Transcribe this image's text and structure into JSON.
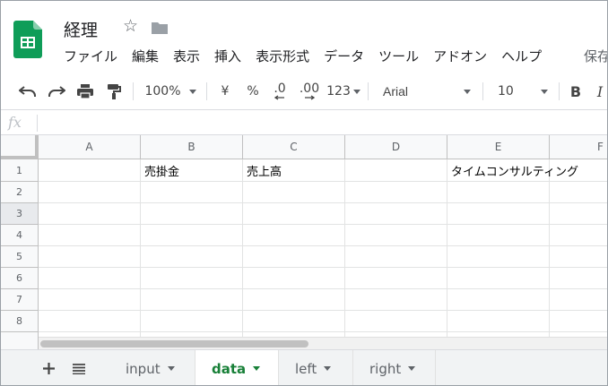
{
  "header": {
    "title": "経理",
    "save_status": "保存"
  },
  "menu": [
    {
      "label": "ファイル"
    },
    {
      "label": "編集"
    },
    {
      "label": "表示"
    },
    {
      "label": "挿入"
    },
    {
      "label": "表示形式"
    },
    {
      "label": "データ"
    },
    {
      "label": "ツール"
    },
    {
      "label": "アドオン"
    },
    {
      "label": "ヘルプ"
    }
  ],
  "toolbar": {
    "zoom": "100%",
    "currency": "¥",
    "percent": "%",
    "decrease_decimal": ".0",
    "increase_decimal": ".00",
    "number_format": "123",
    "font": "Arial",
    "font_size": "10",
    "bold": "B",
    "italic": "I"
  },
  "formula_bar": {
    "fx_label": "fx",
    "value": ""
  },
  "columns": [
    "A",
    "B",
    "C",
    "D",
    "E",
    "F"
  ],
  "rows": [
    "1",
    "2",
    "3",
    "4",
    "5",
    "6",
    "7",
    "8"
  ],
  "cells": {
    "B1": "売掛金",
    "C1": "売上高",
    "E1": "タイムコンサルティング"
  },
  "sheets": [
    {
      "label": "input",
      "active": false
    },
    {
      "label": "data",
      "active": true
    },
    {
      "label": "left",
      "active": false
    },
    {
      "label": "right",
      "active": false
    }
  ],
  "colors": {
    "brand_green": "#0F9D58",
    "active_tab": "#188038"
  },
  "icons": [
    "sheets-logo-icon",
    "star-icon",
    "folder-icon",
    "undo-icon",
    "redo-icon",
    "print-icon",
    "paint-format-icon",
    "add-sheet-icon",
    "all-sheets-icon"
  ]
}
